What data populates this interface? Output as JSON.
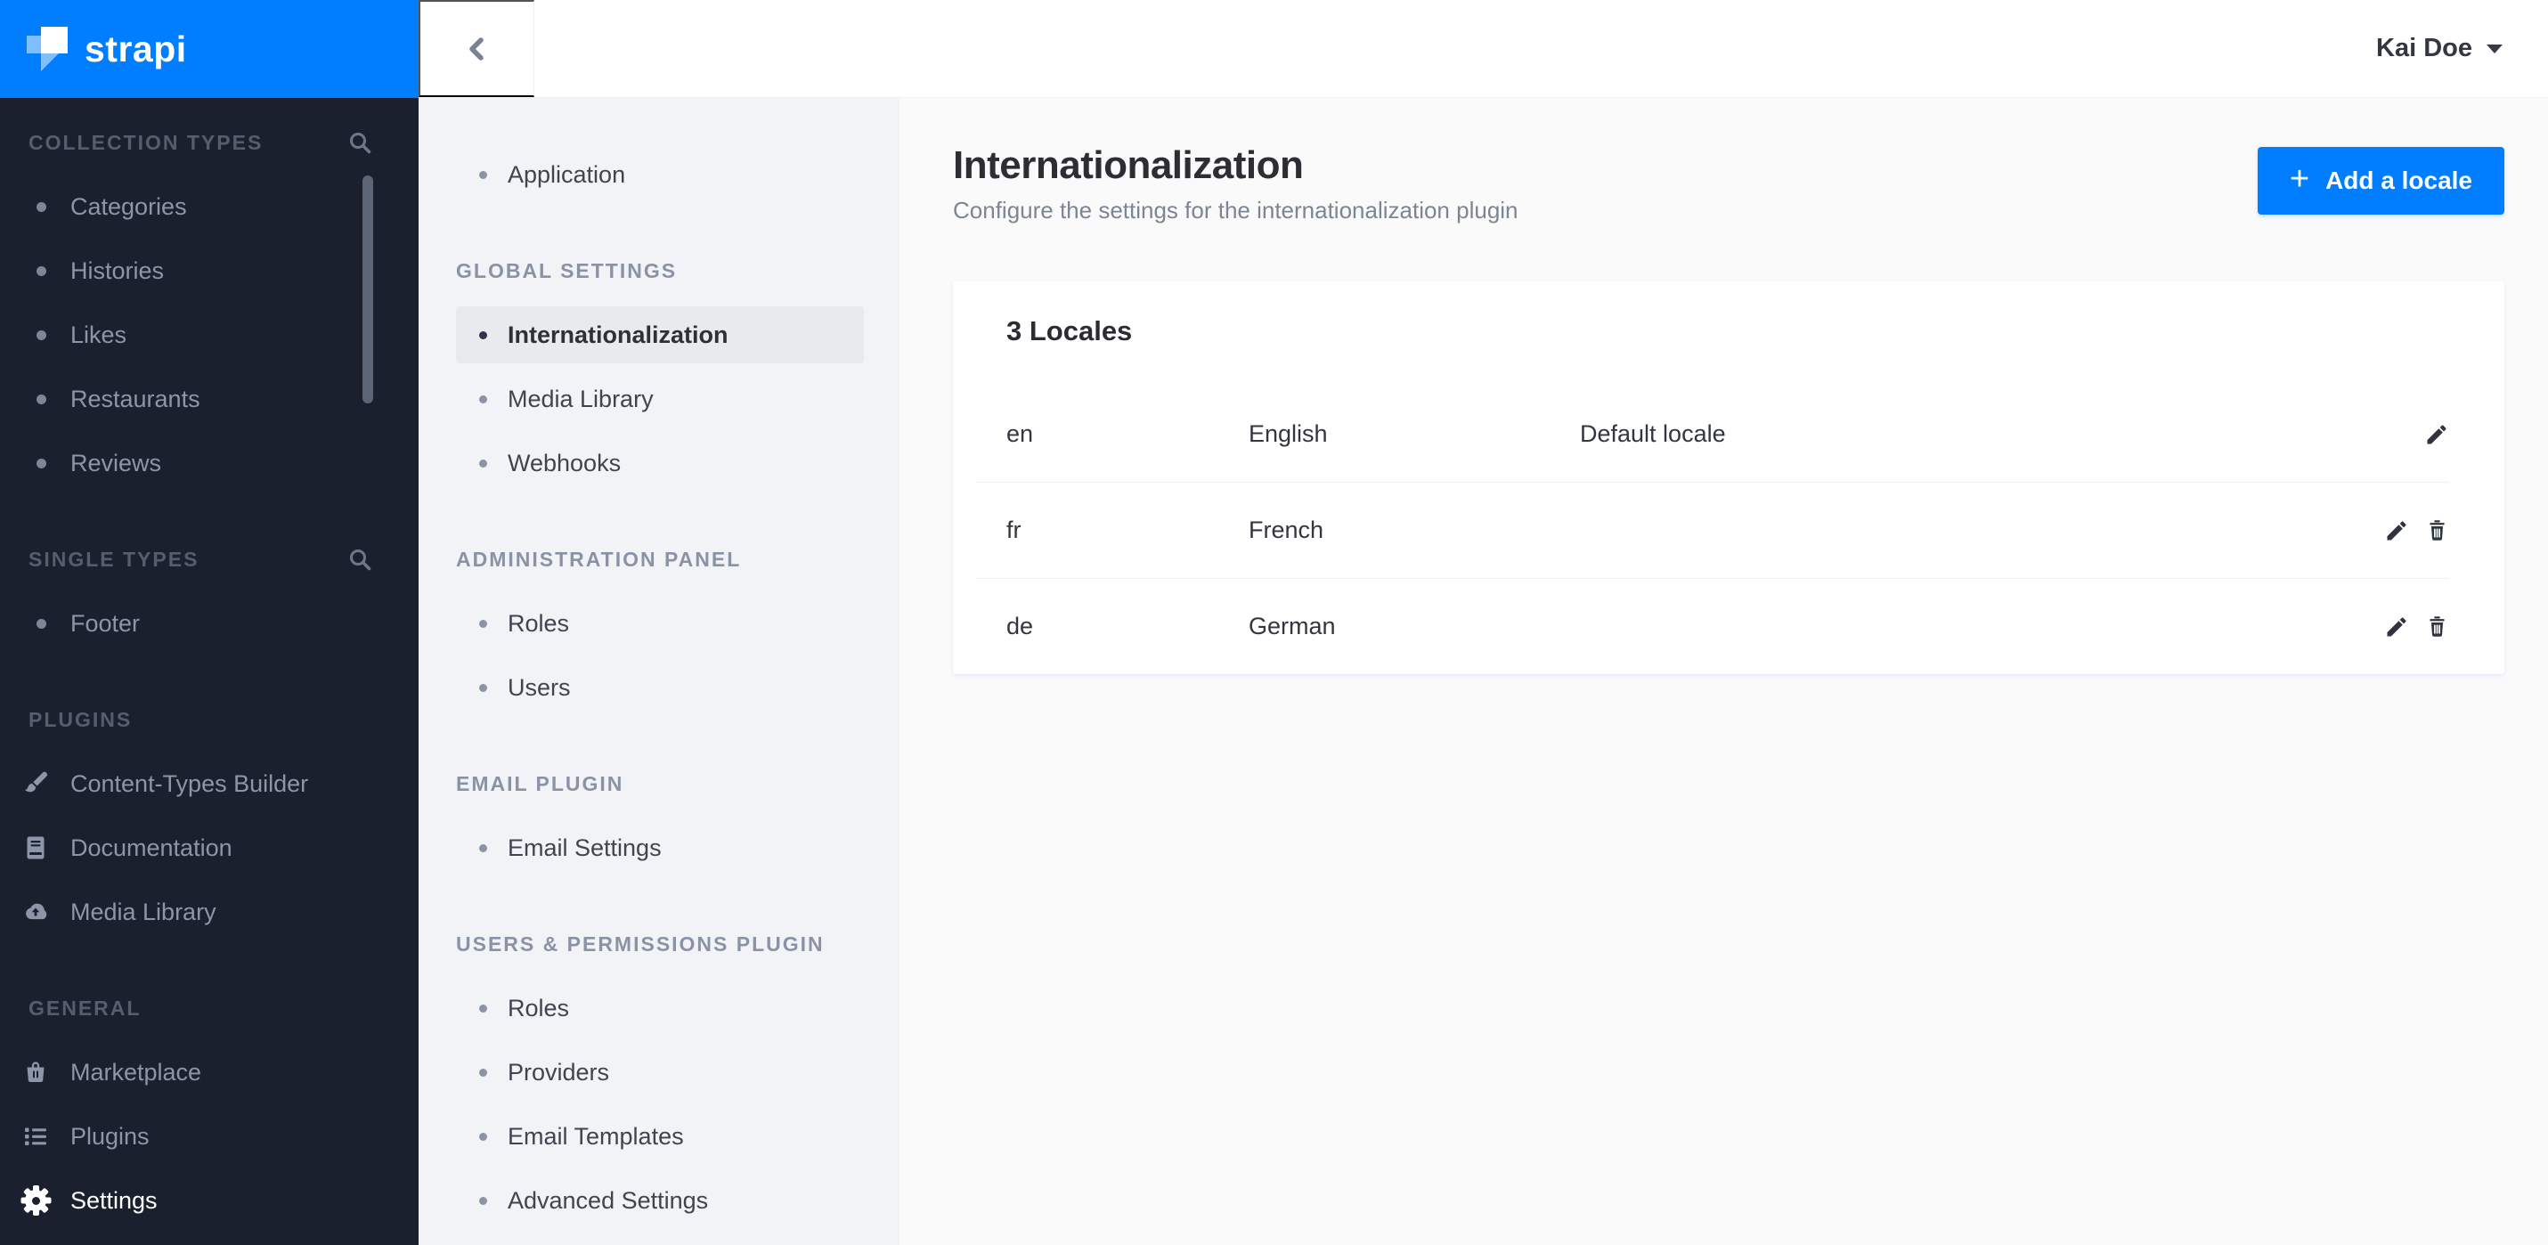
{
  "brand": {
    "name": "strapi",
    "accent_color": "#007eff",
    "sidebar_bg": "#1a202e"
  },
  "topbar": {
    "user_name": "Kai Doe",
    "back_icon": "chevron-left-icon",
    "user_caret_icon": "chevron-down-icon"
  },
  "nav_sidebar": {
    "sections": [
      {
        "title": "COLLECTION TYPES",
        "search_icon": "search-icon",
        "items": [
          {
            "label": "Categories"
          },
          {
            "label": "Histories"
          },
          {
            "label": "Likes"
          },
          {
            "label": "Restaurants"
          },
          {
            "label": "Reviews"
          }
        ]
      },
      {
        "title": "SINGLE TYPES",
        "search_icon": "search-icon",
        "items": [
          {
            "label": "Footer"
          }
        ]
      },
      {
        "title": "PLUGINS",
        "items": [
          {
            "label": "Content-Types Builder",
            "icon": "paintbrush-icon"
          },
          {
            "label": "Documentation",
            "icon": "book-icon"
          },
          {
            "label": "Media Library",
            "icon": "cloud-upload-icon"
          }
        ]
      },
      {
        "title": "GENERAL",
        "items": [
          {
            "label": "Marketplace",
            "icon": "basket-icon"
          },
          {
            "label": "Plugins",
            "icon": "list-icon"
          },
          {
            "label": "Settings",
            "icon": "gear-icon",
            "active": true
          }
        ]
      }
    ]
  },
  "settings_sidebar": {
    "application_item": {
      "label": "Application"
    },
    "sections": [
      {
        "title": "GLOBAL SETTINGS",
        "items": [
          {
            "label": "Internationalization",
            "selected": true
          },
          {
            "label": "Media Library"
          },
          {
            "label": "Webhooks"
          }
        ]
      },
      {
        "title": "ADMINISTRATION PANEL",
        "items": [
          {
            "label": "Roles"
          },
          {
            "label": "Users"
          }
        ]
      },
      {
        "title": "EMAIL PLUGIN",
        "items": [
          {
            "label": "Email Settings"
          }
        ]
      },
      {
        "title": "USERS & PERMISSIONS PLUGIN",
        "items": [
          {
            "label": "Roles"
          },
          {
            "label": "Providers"
          },
          {
            "label": "Email Templates"
          },
          {
            "label": "Advanced Settings"
          }
        ]
      }
    ]
  },
  "page": {
    "title": "Internationalization",
    "subtitle": "Configure the settings for the internationalization plugin",
    "add_locale_button": {
      "label": "Add a locale",
      "icon": "plus-icon"
    }
  },
  "locales_card": {
    "heading": "3 Locales",
    "rows": [
      {
        "code": "en",
        "name": "English",
        "default_label": "Default locale",
        "actions": [
          "edit"
        ]
      },
      {
        "code": "fr",
        "name": "French",
        "default_label": "",
        "actions": [
          "edit",
          "delete"
        ]
      },
      {
        "code": "de",
        "name": "German",
        "default_label": "",
        "actions": [
          "edit",
          "delete"
        ]
      }
    ]
  }
}
